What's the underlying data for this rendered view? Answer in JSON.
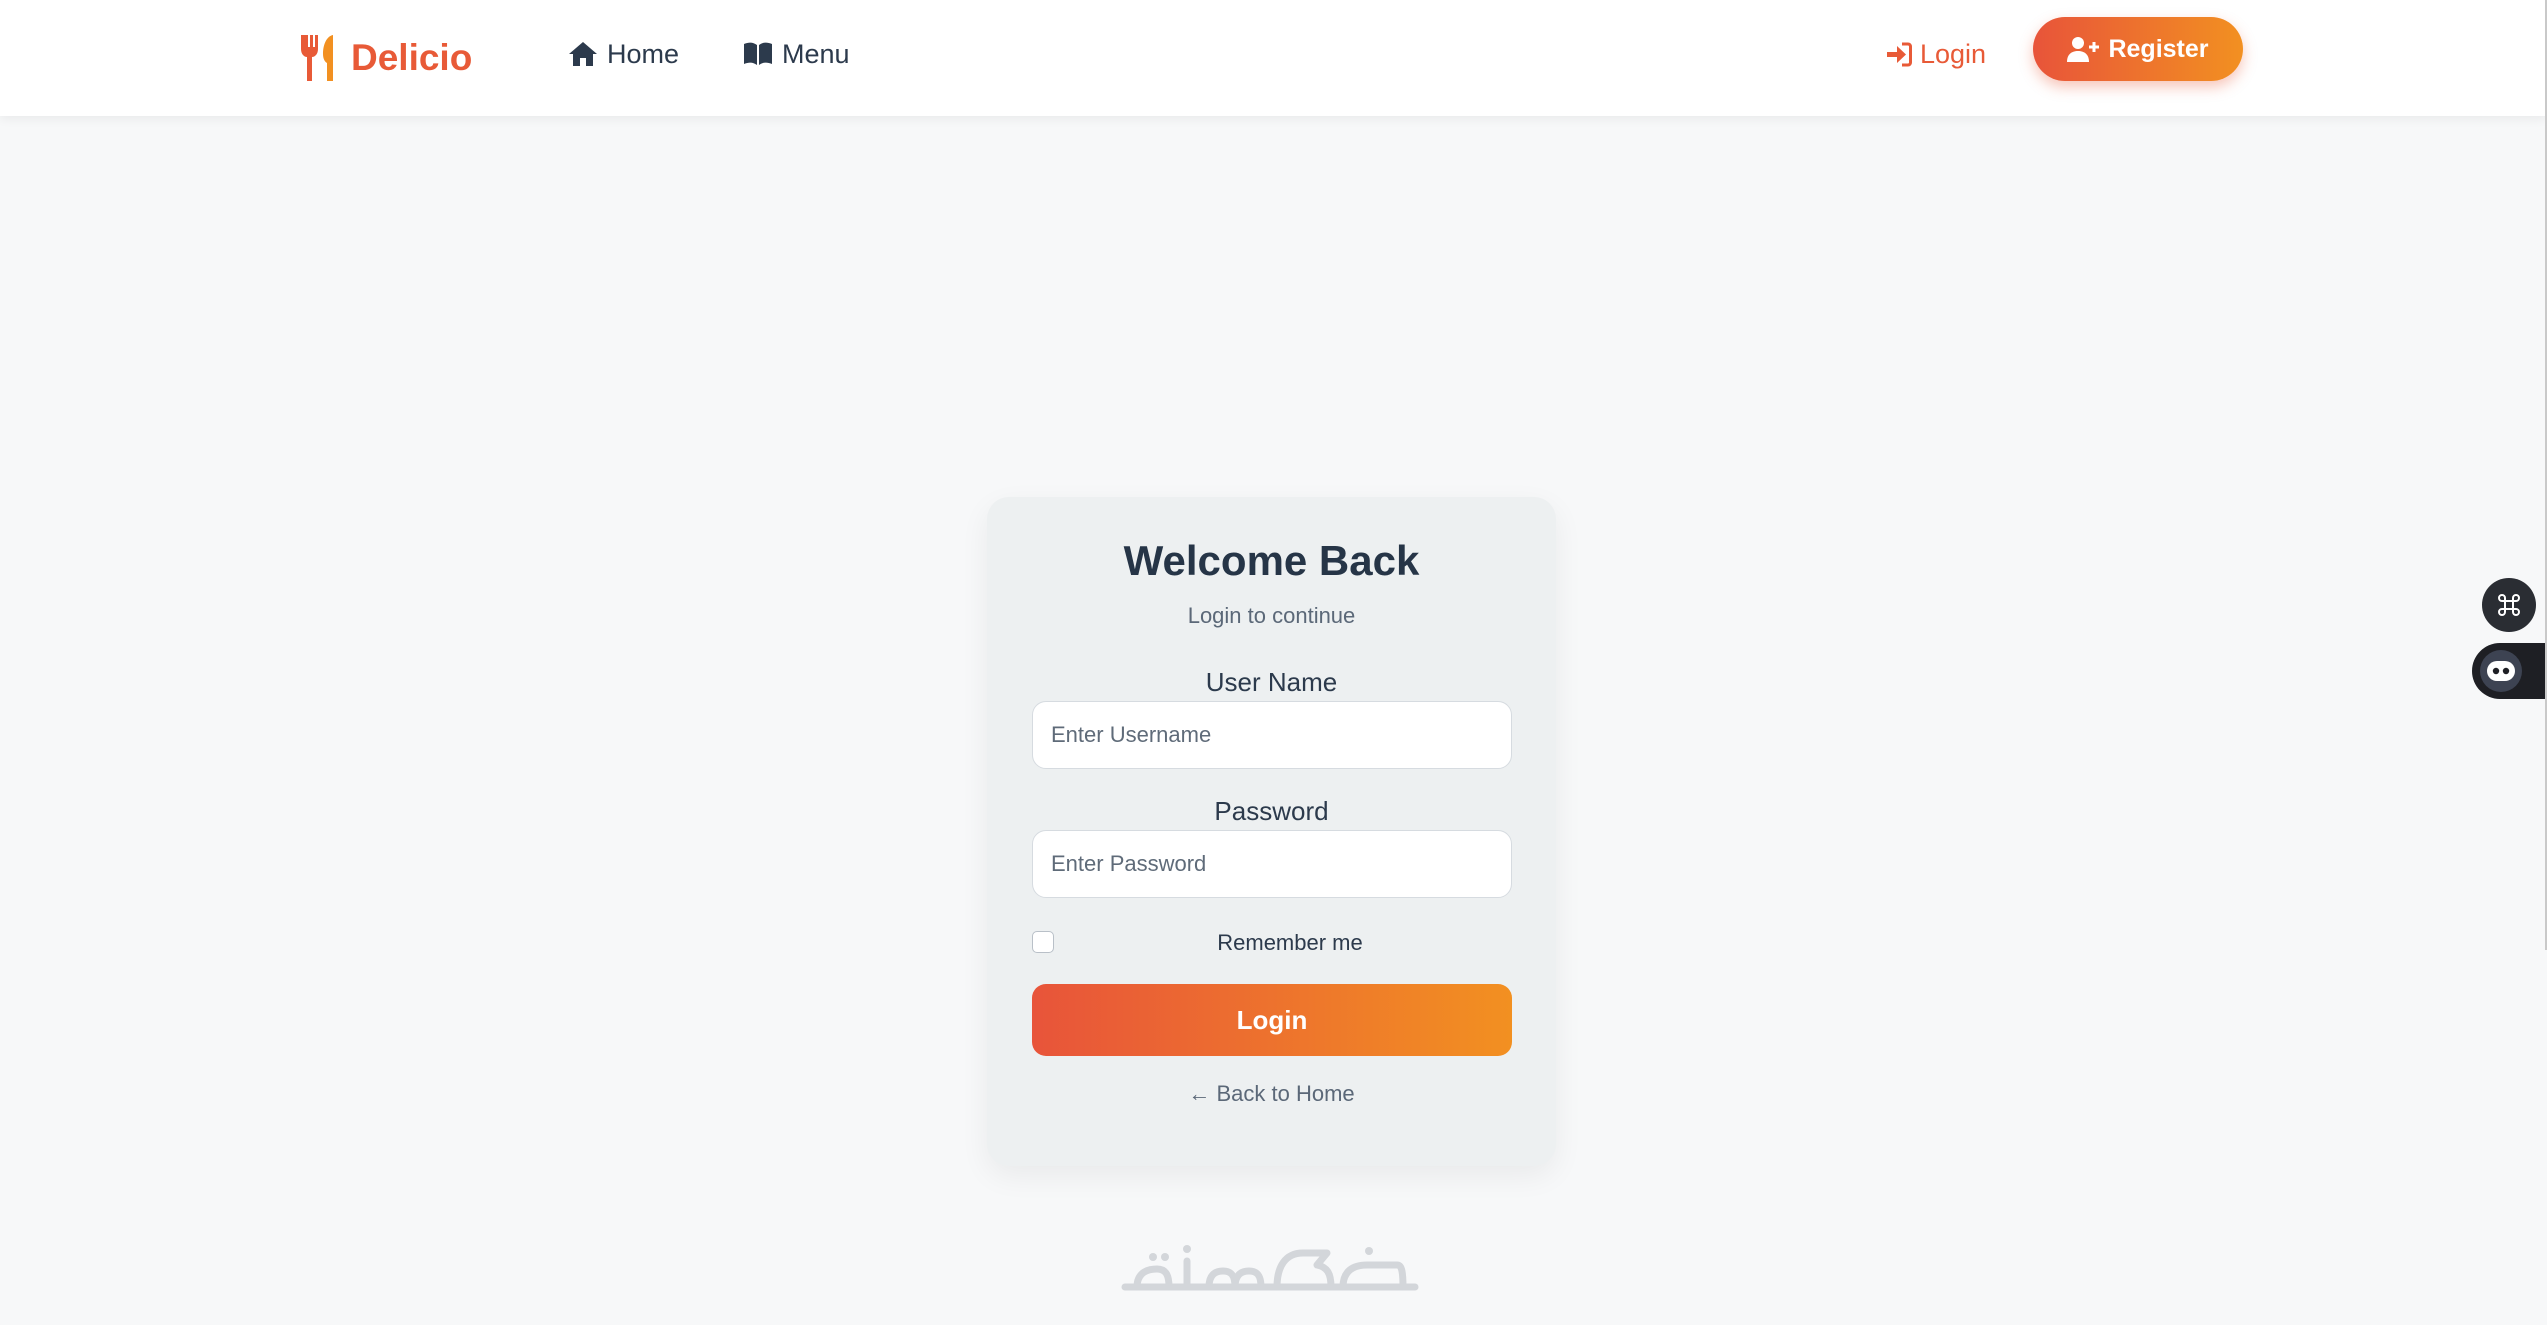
{
  "brand": {
    "name": "Delicio",
    "icon": "utensils-icon",
    "color": "#e85a37"
  },
  "nav": {
    "home": {
      "label": "Home",
      "icon": "home-icon"
    },
    "menu": {
      "label": "Menu",
      "icon": "book-open-icon"
    },
    "login": {
      "label": "Login",
      "icon": "sign-in-icon"
    },
    "register": {
      "label": "Register",
      "icon": "user-plus-icon"
    }
  },
  "login_card": {
    "title": "Welcome Back",
    "subtitle": "Login to continue",
    "username_label": "User Name",
    "username_placeholder": "Enter Username",
    "username_value": "",
    "password_label": "Password",
    "password_placeholder": "Enter Password",
    "password_value": "",
    "remember_label": "Remember me",
    "remember_checked": false,
    "submit_label": "Login",
    "back_link": "← Back to Home"
  },
  "colors": {
    "accent_start": "#e8543a",
    "accent_end": "#f29021",
    "text_dark": "#2c3a4c",
    "background": "#f7f8f9"
  },
  "side_widgets": [
    {
      "icon": "command-icon"
    },
    {
      "icon": "robot-face-icon"
    }
  ]
}
